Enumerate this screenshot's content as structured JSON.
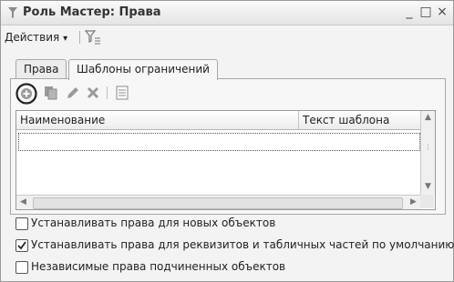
{
  "window": {
    "title": "Роль Мастер: Права",
    "controls": [
      "_",
      "□",
      "×"
    ]
  },
  "toolbar": {
    "actions_label": "Действия",
    "actions_arrow": "▾"
  },
  "tabs": [
    {
      "label": "Права",
      "active": false
    },
    {
      "label": "Шаблоны ограничений",
      "active": true
    }
  ],
  "table": {
    "columns": [
      "Наименование",
      "Текст шаблона"
    ],
    "rows": []
  },
  "options": [
    {
      "label": "Устанавливать права для новых объектов",
      "checked": false
    },
    {
      "label": "Устанавливать права для реквизитов и табличных частей по умолчанию",
      "checked": true
    },
    {
      "label": "Независимые права подчиненных объектов",
      "checked": false
    }
  ],
  "icons": {
    "title": "filter-funnel-icon",
    "toolbar2": [
      "add-icon",
      "copy-icon",
      "edit-icon",
      "delete-icon",
      "settings-list-icon"
    ]
  }
}
